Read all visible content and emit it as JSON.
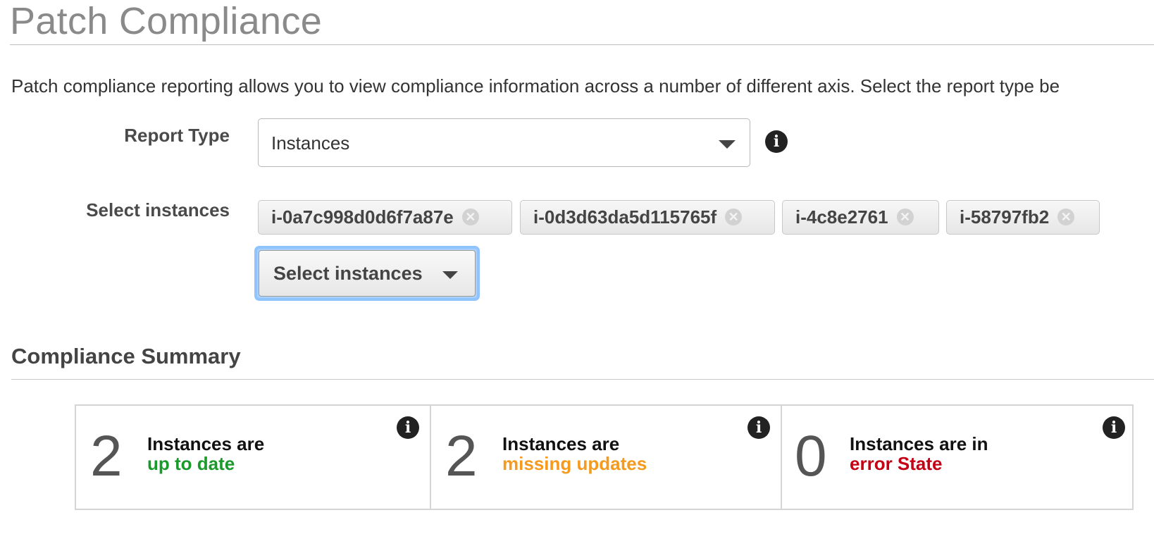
{
  "page": {
    "title": "Patch Compliance",
    "description": "Patch compliance reporting allows you to view compliance information across a number of different axis. Select the report type be"
  },
  "report_type": {
    "label": "Report Type",
    "value": "Instances",
    "icon": "info-icon"
  },
  "select_instances": {
    "label": "Select instances",
    "tags": [
      {
        "label": "i-0a7c998d0d6f7a87e",
        "remove_glyph": "✕"
      },
      {
        "label": "i-0d3d63da5d115765f",
        "remove_glyph": "✕"
      },
      {
        "label": "i-4c8e2761",
        "remove_glyph": "✕"
      },
      {
        "label": "i-58797fb2",
        "remove_glyph": "✕"
      }
    ],
    "dropdown_label": "Select instances"
  },
  "compliance_summary": {
    "title": "Compliance Summary",
    "info_glyph": "i",
    "cards": [
      {
        "count": "2",
        "line1": "Instances are",
        "line2": "up to date",
        "status_color": "#1a9a2a"
      },
      {
        "count": "2",
        "line1": "Instances are",
        "line2": "missing updates",
        "status_color": "#f59a1d"
      },
      {
        "count": "0",
        "line1": "Instances are in",
        "line2": "error State",
        "status_color": "#c40014"
      }
    ]
  }
}
